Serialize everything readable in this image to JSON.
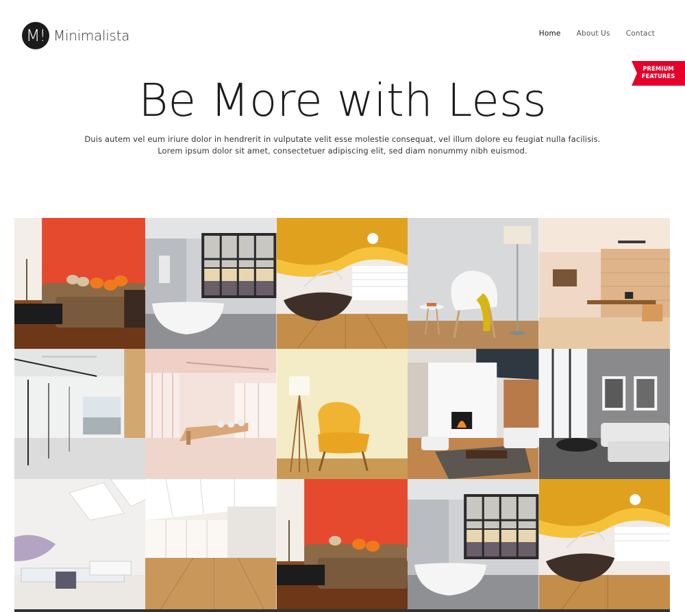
{
  "brand": {
    "logo_letter": "M!",
    "name": "Minimalista"
  },
  "nav": {
    "items": [
      {
        "label": "Home",
        "active": true
      },
      {
        "label": "About Us",
        "active": false
      },
      {
        "label": "Contact",
        "active": false
      }
    ]
  },
  "ribbon": {
    "line1": "PREMIUM",
    "line2": "FEATURES"
  },
  "hero": {
    "title": "Be More with Less",
    "text_line1": "Duis autem vel eum iriure dolor in hendrerit in vulputate velit esse molestie consequat, vel illum dolore eu feugiat nulla facilisis.",
    "text_line2": "Lorem ipsum dolor sit amet, consectetuer adipiscing elit, sed diam nonummy nibh euismod."
  },
  "colors": {
    "accent": "#e4002b",
    "dark": "#1b1b1b"
  },
  "gallery": {
    "tiles": [
      {
        "scene": "red-wall-living-room"
      },
      {
        "scene": "grey-bathroom-window"
      },
      {
        "scene": "orange-ceiling-lounge"
      },
      {
        "scene": "white-chair-lamp"
      },
      {
        "scene": "warm-office-interior"
      },
      {
        "scene": "glass-partition-office"
      },
      {
        "scene": "bright-conference-room"
      },
      {
        "scene": "yellow-armchair-lamp"
      },
      {
        "scene": "fireplace-living-room"
      },
      {
        "scene": "grey-sofa-artwork"
      },
      {
        "scene": "skylight-white-room"
      },
      {
        "scene": "empty-loft-windows"
      },
      {
        "scene": "red-wall-living-room"
      },
      {
        "scene": "grey-bathroom-window"
      },
      {
        "scene": "orange-ceiling-lounge"
      }
    ]
  }
}
